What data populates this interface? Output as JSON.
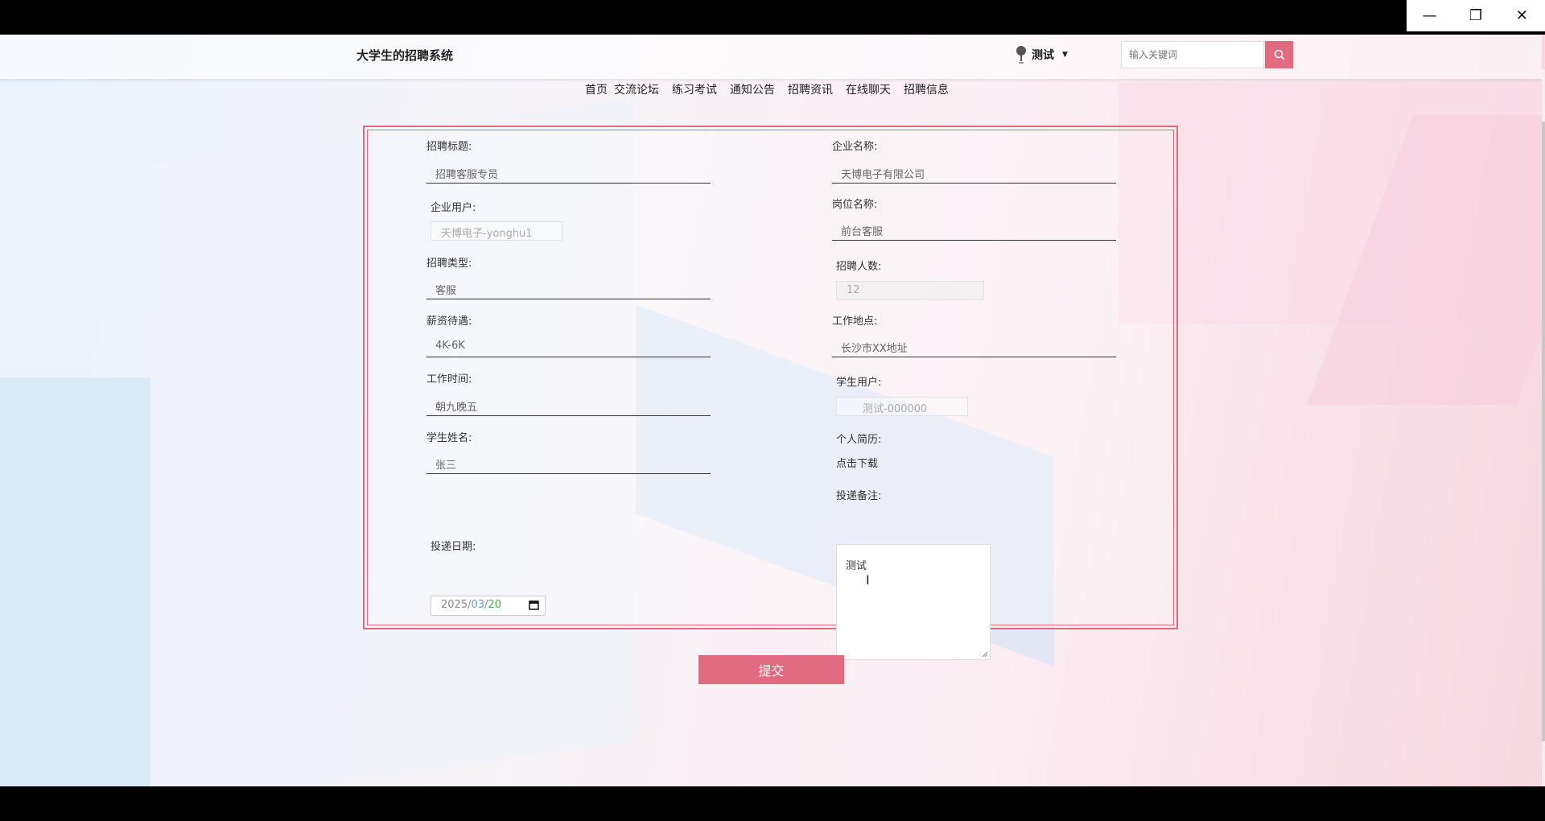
{
  "window": {
    "minimize": "—",
    "restore": "❐",
    "close": "✕"
  },
  "header": {
    "site_title": "大学生的招聘系统",
    "user_name": "测试",
    "search_placeholder": "输入关键词"
  },
  "nav": [
    "首页",
    "交流论坛",
    "练习考试",
    "通知公告",
    "招聘资讯",
    "在线聊天",
    "招聘信息"
  ],
  "form": {
    "recruit_title": {
      "label": "招聘标题:",
      "value": "招聘客服专员"
    },
    "company_name": {
      "label": "企业名称:",
      "value": "天博电子有限公司"
    },
    "company_user": {
      "label": "企业用户:",
      "value": "天博电子-yonghu1"
    },
    "position_name": {
      "label": "岗位名称:",
      "value": "前台客服"
    },
    "recruit_type": {
      "label": "招聘类型:",
      "value": "客服"
    },
    "headcount": {
      "label": "招聘人数:",
      "value": "12"
    },
    "salary": {
      "label": "薪资待遇:",
      "value": "4K-6K"
    },
    "work_location": {
      "label": "工作地点:",
      "value": "长沙市XX地址"
    },
    "work_time": {
      "label": "工作时间:",
      "value": "朝九晚五"
    },
    "student_user": {
      "label": "学生用户:",
      "value": "测试-000000"
    },
    "student_name": {
      "label": "学生姓名:",
      "value": "张三"
    },
    "resume": {
      "label": "个人简历:",
      "value": "点击下载"
    },
    "note": {
      "label": "投递备注:",
      "value": "测试"
    },
    "date": {
      "label": "投递日期:",
      "year": "2025",
      "month": "03",
      "day": "20"
    }
  },
  "submit_label": "提交",
  "colors": {
    "accent": "#e06a80"
  }
}
